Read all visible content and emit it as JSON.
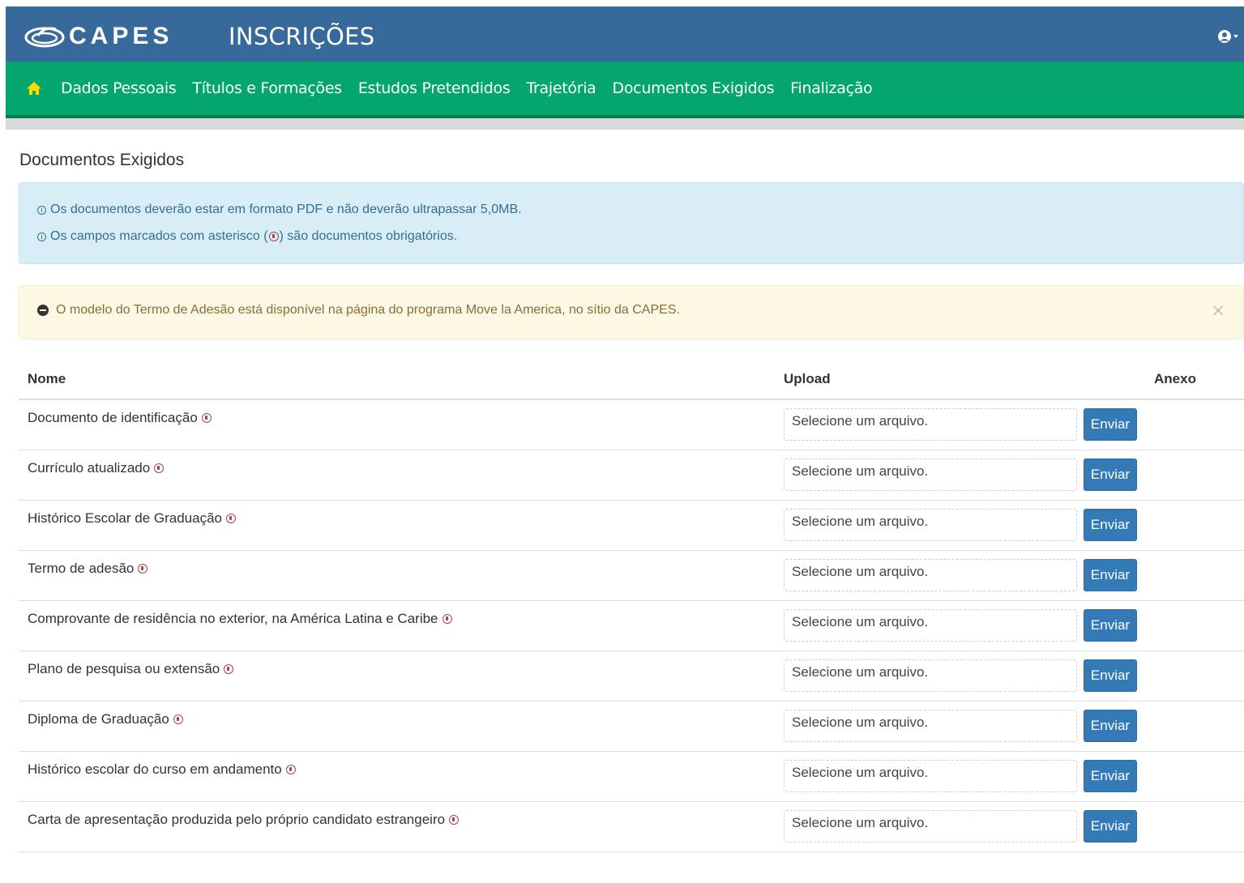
{
  "header": {
    "logo_text": "CAPES",
    "app_title": "INSCRIÇÕES",
    "user_icon": "user-circle-icon"
  },
  "nav": {
    "home_icon": "home-icon",
    "items": [
      {
        "label": "Dados Pessoais"
      },
      {
        "label": "Títulos e Formações"
      },
      {
        "label": "Estudos Pretendidos"
      },
      {
        "label": "Trajetória"
      },
      {
        "label": "Documentos Exigidos"
      },
      {
        "label": "Finalização"
      }
    ]
  },
  "page": {
    "title": "Documentos Exigidos"
  },
  "info": {
    "line1": "Os documentos deverão estar em formato PDF e não deverão ultrapassar 5,0MB.",
    "line2_before": "Os campos marcados com asterisco (",
    "line2_after": ") são documentos obrigatórios."
  },
  "warning": {
    "text": "O modelo do Termo de Adesão está disponível na página do programa Move la America, no sítio da CAPES.",
    "close": "×"
  },
  "table": {
    "headers": {
      "name": "Nome",
      "upload": "Upload",
      "anexo": "Anexo"
    },
    "file_placeholder": "Selecione um arquivo.",
    "send_label": "Enviar",
    "rows": [
      {
        "name": "Documento de identificação"
      },
      {
        "name": "Currículo atualizado"
      },
      {
        "name": "Histórico Escolar de Graduação"
      },
      {
        "name": "Termo de adesão"
      },
      {
        "name": "Comprovante de residência no exterior, na América Latina e Caribe"
      },
      {
        "name": "Plano de pesquisa ou extensão"
      },
      {
        "name": "Diploma de Graduação"
      },
      {
        "name": "Histórico escolar do curso em andamento"
      },
      {
        "name": "Carta de apresentação produzida pelo próprio candidato estrangeiro"
      }
    ]
  },
  "colors": {
    "header_blue": "#376a9a",
    "nav_green": "#03a66c",
    "button_blue": "#337ab7",
    "required_red": "#a94442"
  }
}
